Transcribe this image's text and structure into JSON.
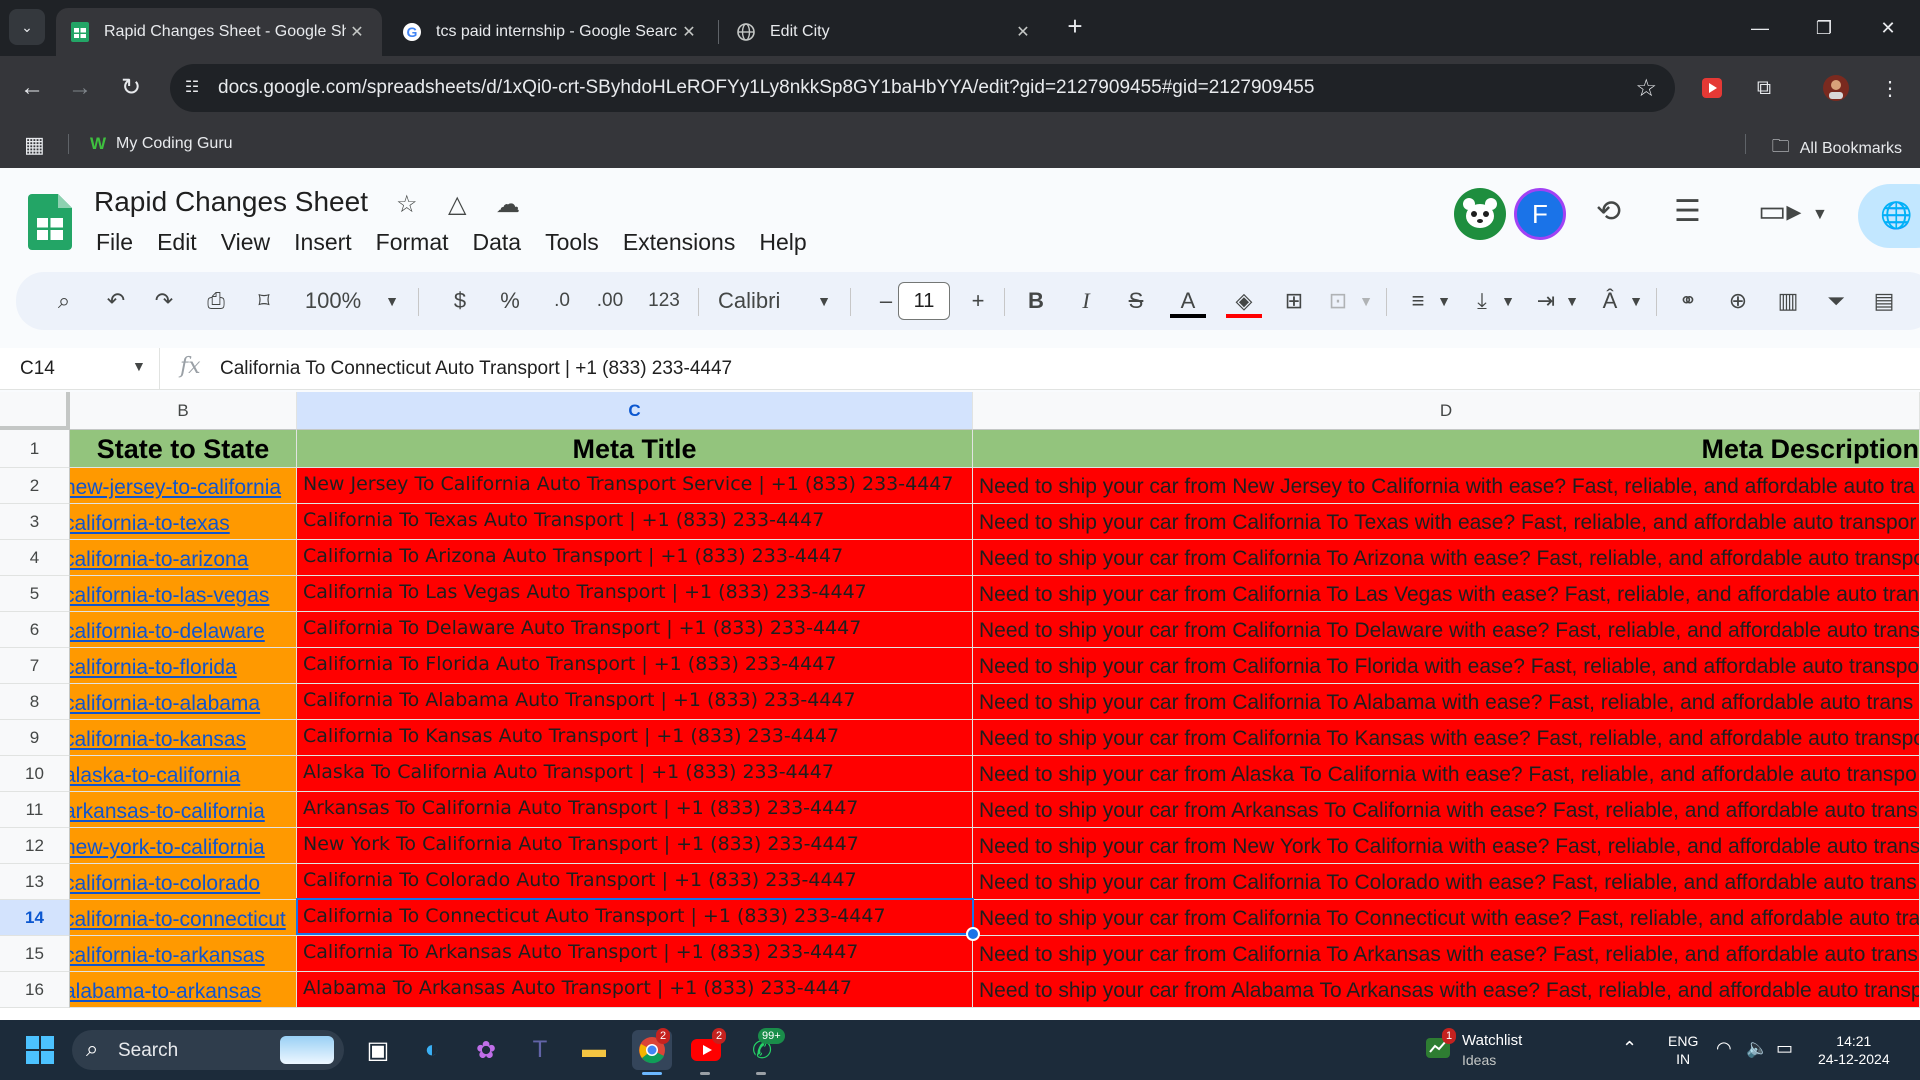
{
  "browser": {
    "tabs": [
      {
        "title": "Rapid Changes Sheet - Google Sheets",
        "favicon": "sheets-icon",
        "active": true
      },
      {
        "title": "tcs paid internship - Google Search",
        "favicon": "google-icon",
        "active": false
      },
      {
        "title": "Edit City",
        "favicon": "globe-icon",
        "active": false
      }
    ],
    "url": "docs.google.com/spreadsheets/d/1xQi0-crt-SByhdoHLeROFYy1Ly8nkkSp8GY1baHbYYA/edit?gid=2127909455#gid=2127909455",
    "bookmarks": {
      "item": "My Coding Guru",
      "all": "All Bookmarks"
    }
  },
  "doc": {
    "title": "Rapid Changes Sheet",
    "menu": [
      "File",
      "Edit",
      "View",
      "Insert",
      "Format",
      "Data",
      "Tools",
      "Extensions",
      "Help"
    ],
    "avatar_letter": "F"
  },
  "toolbar": {
    "zoom": "100%",
    "currency": "$",
    "percent": "%",
    "dec_decrease": ".0",
    "dec_increase": ".00",
    "number_format": "123",
    "font": "Calibri",
    "font_size": "11",
    "bold": "B",
    "italic": "I"
  },
  "formula_bar": {
    "cell_ref": "C14",
    "fx": "fx",
    "content": "California To Connecticut Auto Transport | +1 (833) 233-4447"
  },
  "grid": {
    "columns": [
      "B",
      "C",
      "D"
    ],
    "selected_column": "C",
    "selected_row": "14",
    "row_numbers": [
      "1",
      "2",
      "3",
      "4",
      "5",
      "6",
      "7",
      "8",
      "9",
      "10",
      "11",
      "12",
      "13",
      "14",
      "15",
      "16"
    ],
    "headers": {
      "b": "State to State",
      "c": "Meta Title",
      "d": "Meta Description"
    },
    "rows": [
      {
        "b": "new-jersey-to-california",
        "c": "New Jersey To California Auto Transport Service | +1 (833) 233-4447",
        "d": "Need to ship your car from New Jersey to California with ease? Fast, reliable, and affordable auto tra"
      },
      {
        "b": "california-to-texas",
        "c": "California To Texas Auto Transport | +1 (833) 233-4447",
        "d": "Need to ship your car from California To Texas with ease? Fast, reliable, and affordable auto transpor"
      },
      {
        "b": "california-to-arizona",
        "c": "California To Arizona Auto Transport | +1 (833) 233-4447",
        "d": "Need to ship your car from California To Arizona with ease? Fast, reliable, and affordable auto transpo"
      },
      {
        "b": "california-to-las-vegas",
        "c": "California To Las Vegas Auto Transport | +1 (833) 233-4447",
        "d": "Need to ship your car from California To Las Vegas with ease? Fast, reliable, and affordable auto tran"
      },
      {
        "b": "california-to-delaware",
        "c": "California To Delaware Auto Transport | +1 (833) 233-4447",
        "d": "Need to ship your car from California To Delaware with ease? Fast, reliable, and affordable auto trans"
      },
      {
        "b": "california-to-florida",
        "c": "California To Florida Auto Transport | +1 (833) 233-4447",
        "d": "Need to ship your car from California To Florida with ease? Fast, reliable, and affordable auto transpo"
      },
      {
        "b": "california-to-alabama",
        "c": "California To Alabama Auto Transport | +1 (833) 233-4447",
        "d": "Need to ship your car from California To Alabama with ease? Fast, reliable, and affordable auto trans"
      },
      {
        "b": "california-to-kansas",
        "c": "California To Kansas Auto Transport | +1 (833) 233-4447",
        "d": "Need to ship your car from California To Kansas with ease? Fast, reliable, and affordable auto transpo"
      },
      {
        "b": "alaska-to-california",
        "c": "Alaska To California Auto Transport | +1 (833) 233-4447",
        "d": "Need to ship your car from Alaska To California with ease? Fast, reliable, and affordable auto transpo"
      },
      {
        "b": "arkansas-to-california",
        "c": "Arkansas To California Auto Transport | +1 (833) 233-4447",
        "d": "Need to ship your car from Arkansas To California with ease? Fast, reliable, and affordable auto trans"
      },
      {
        "b": "new-york-to-california",
        "c": "New York To California Auto Transport | +1 (833) 233-4447",
        "d": "Need to ship your car from New York To California with ease? Fast, reliable, and affordable auto trans"
      },
      {
        "b": "california-to-colorado",
        "c": "California To Colorado Auto Transport | +1 (833) 233-4447",
        "d": "Need to ship your car from California To Colorado with ease? Fast, reliable, and affordable auto trans"
      },
      {
        "b": "california-to-connecticut",
        "c": "California To Connecticut Auto Transport | +1 (833) 233-4447",
        "d": "Need to ship your car from California To Connecticut with ease? Fast, reliable, and affordable auto tra"
      },
      {
        "b": "california-to-arkansas",
        "c": "California To Arkansas Auto Transport | +1 (833) 233-4447",
        "d": "Need to ship your car from California To Arkansas with ease? Fast, reliable, and affordable auto trans"
      },
      {
        "b": "alabama-to-arkansas",
        "c": "Alabama To Arkansas Auto Transport | +1 (833) 233-4447",
        "d": "Need to ship your car from Alabama To Arkansas with ease? Fast, reliable, and affordable auto transp"
      }
    ]
  },
  "colors": {
    "header_fill": "#93c47d",
    "col_b_fill": "#ff9900",
    "col_cd_fill": "#ff0000",
    "link": "#1155cc",
    "selection": "#1a73e8"
  },
  "taskbar": {
    "search": "Search",
    "chrome_badge": "2",
    "youtube_badge": "2",
    "whatsapp_badge": "99+",
    "watchlist_badge": "1",
    "watchlist": "Watchlist",
    "watchlist_sub": "Ideas",
    "lang1": "ENG",
    "lang2": "IN",
    "time": "14:21",
    "date": "24-12-2024"
  }
}
